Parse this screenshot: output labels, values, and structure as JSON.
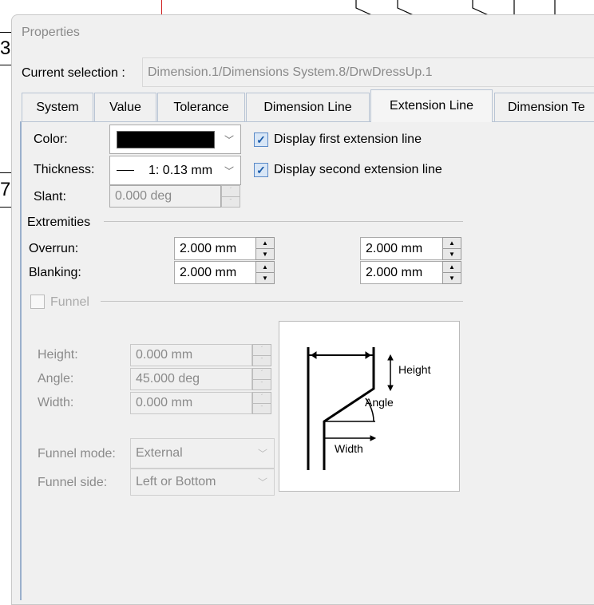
{
  "background": {
    "box_labels": [
      "3",
      "7"
    ]
  },
  "dialog": {
    "title": "Properties",
    "current_selection_label": "Current selection :",
    "current_selection_value": "Dimension.1/Dimensions System.8/DrwDressUp.1",
    "tabs": [
      {
        "label": "System"
      },
      {
        "label": "Value"
      },
      {
        "label": "Tolerance"
      },
      {
        "label": "Dimension Line"
      },
      {
        "label": "Extension Line",
        "selected": true
      },
      {
        "label": "Dimension Te"
      }
    ],
    "color": {
      "label": "Color:",
      "value": "#000000"
    },
    "thickness": {
      "label": "Thickness:",
      "value": "1: 0.13 mm"
    },
    "slant": {
      "label": "Slant:",
      "value": "0.000 deg"
    },
    "display_first": {
      "label": "Display first extension line",
      "checked": true
    },
    "display_second": {
      "label": "Display second extension line",
      "checked": true
    },
    "extremities": {
      "label": "Extremities",
      "overrun": {
        "label": "Overrun:",
        "value1": "2.000 mm",
        "value2": "2.000 mm"
      },
      "blanking": {
        "label": "Blanking:",
        "value1": "2.000 mm",
        "value2": "2.000 mm"
      }
    },
    "funnel": {
      "label": "Funnel",
      "checked": false,
      "height": {
        "label": "Height:",
        "value": "0.000 mm"
      },
      "angle": {
        "label": "Angle:",
        "value": "45.000 deg"
      },
      "width": {
        "label": "Width:",
        "value": "0.000 mm"
      },
      "mode": {
        "label": "Funnel mode:",
        "value": "External"
      },
      "side": {
        "label": "Funnel side:",
        "value": "Left or Bottom"
      },
      "diagram": {
        "height": "Height",
        "angle": "Angle",
        "width": "Width"
      }
    }
  }
}
